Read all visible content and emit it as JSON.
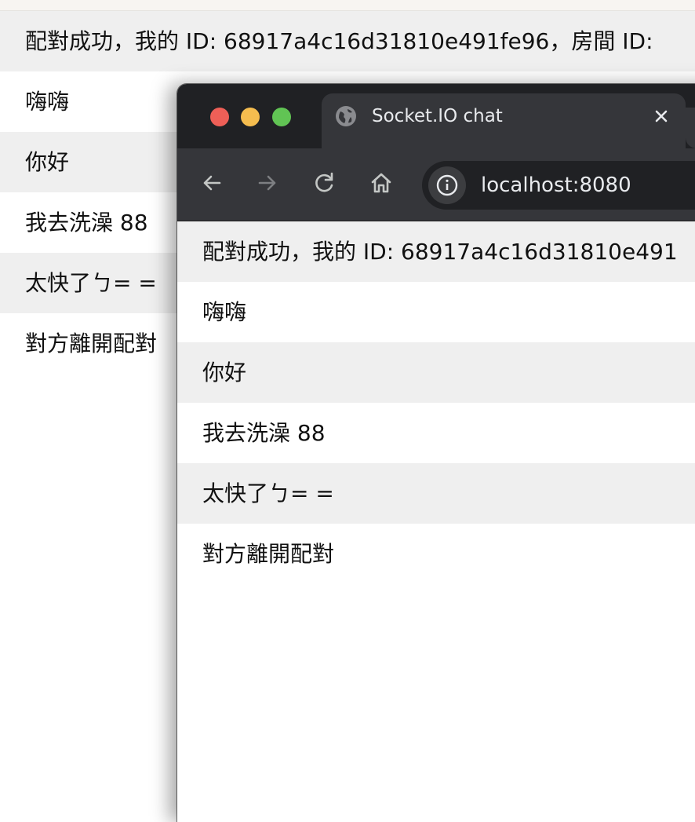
{
  "background_page": {
    "messages": [
      "配對成功，我的 ID: 68917a4c16d31810e491fe96，房間 ID: ",
      "嗨嗨",
      "你好",
      "我去洗澡 88",
      "太快了ㄅ= =",
      "對方離開配對"
    ]
  },
  "browser": {
    "tab": {
      "title": "Socket.IO chat",
      "favicon": "globe-icon",
      "close": "close-icon"
    },
    "toolbar": {
      "back": "back-arrow-icon",
      "forward": "forward-arrow-icon",
      "reload": "reload-icon",
      "home": "home-icon",
      "site_info": "info-icon",
      "url": "localhost:8080"
    },
    "colors": {
      "tabbar_bg": "#202124",
      "tab_bg": "#35363a",
      "traffic_red": "#ee5f57",
      "traffic_yellow": "#f5bd4f",
      "traffic_green": "#61c454",
      "row_alt": "#efefef"
    }
  },
  "foreground_page": {
    "messages": [
      "配對成功，我的 ID: 68917a4c16d31810e491",
      "嗨嗨",
      "你好",
      "我去洗澡 88",
      "太快了ㄅ= =",
      "對方離開配對"
    ]
  }
}
